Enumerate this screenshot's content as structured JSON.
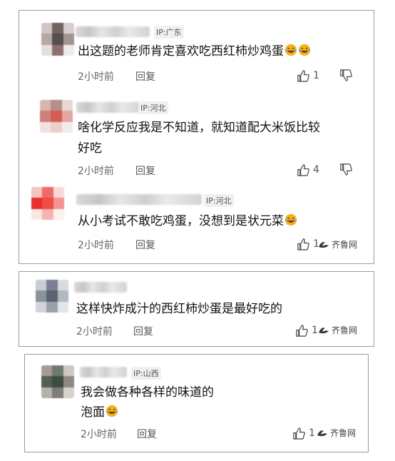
{
  "comments": [
    {
      "ip": "IP:广东",
      "text": "出这题的老师肯定喜欢吃西红柿炒鸡蛋",
      "emoji_count": 2,
      "time": "2小时前",
      "reply": "回复",
      "likes": "1",
      "avatar_colors": [
        "#cfc6c4",
        "#6f6462",
        "#d7d0cf",
        "#b9a7a6",
        "#54504f",
        "#a49391",
        "#e4dfdf",
        "#8d6f6d",
        "#f0ebeb"
      ]
    },
    {
      "ip": "IP:河北",
      "text_lines": [
        "啥化学反应我是不知道，就知道配大米饭比较",
        "好吃"
      ],
      "time": "2小时前",
      "reply": "回复",
      "likes": "4",
      "avatar_colors": [
        "#d9b5b0",
        "#b58f8a",
        "#e7d7d5",
        "#cc807a",
        "#d65d55",
        "#e3a8a3",
        "#f0e2e0",
        "#e9d0cd",
        "#f4ecea"
      ]
    },
    {
      "ip": "IP:河北",
      "text": "从小考试不敢吃鸡蛋，没想到是状元菜",
      "emoji_count": 1,
      "time": "2小时前",
      "reply": "回复",
      "likes": "1",
      "avatar_colors": [
        "#f5c3c1",
        "#f06a66",
        "#f7d9d8",
        "#e8312d",
        "#ee4c47",
        "#f39491",
        "#fbe5e4",
        "#f6b4b1",
        "#fdf1f0"
      ]
    },
    {
      "ip": "",
      "text": "这样快炸成汁的西红柿炒蛋是最好吃的",
      "time": "2小时前",
      "reply": "回复",
      "likes": "1",
      "avatar_colors": [
        "#c8ccd3",
        "#7c7f96",
        "#d9dbe1",
        "#8a929c",
        "#5c6371",
        "#b3b9c2",
        "#d1d4da",
        "#9aa1aa",
        "#e4e6ea"
      ]
    },
    {
      "ip": "IP:山西",
      "text_lines": [
        "我会做各种各样的味道的",
        "泡面"
      ],
      "emoji_count": 1,
      "time": "2小时前",
      "reply": "回复",
      "likes": "1",
      "avatar_colors": [
        "#a59a94",
        "#6f7a6e",
        "#cfc7c2",
        "#555e54",
        "#3f4a43",
        "#8e8a83",
        "#b8b1ab",
        "#7c7f77",
        "#d8d2cd"
      ]
    }
  ],
  "watermark": "齐鲁网",
  "colors": {
    "border": "#9a9a9a",
    "text": "#111111",
    "meta": "#666666",
    "emoji": "#f3b21c"
  }
}
